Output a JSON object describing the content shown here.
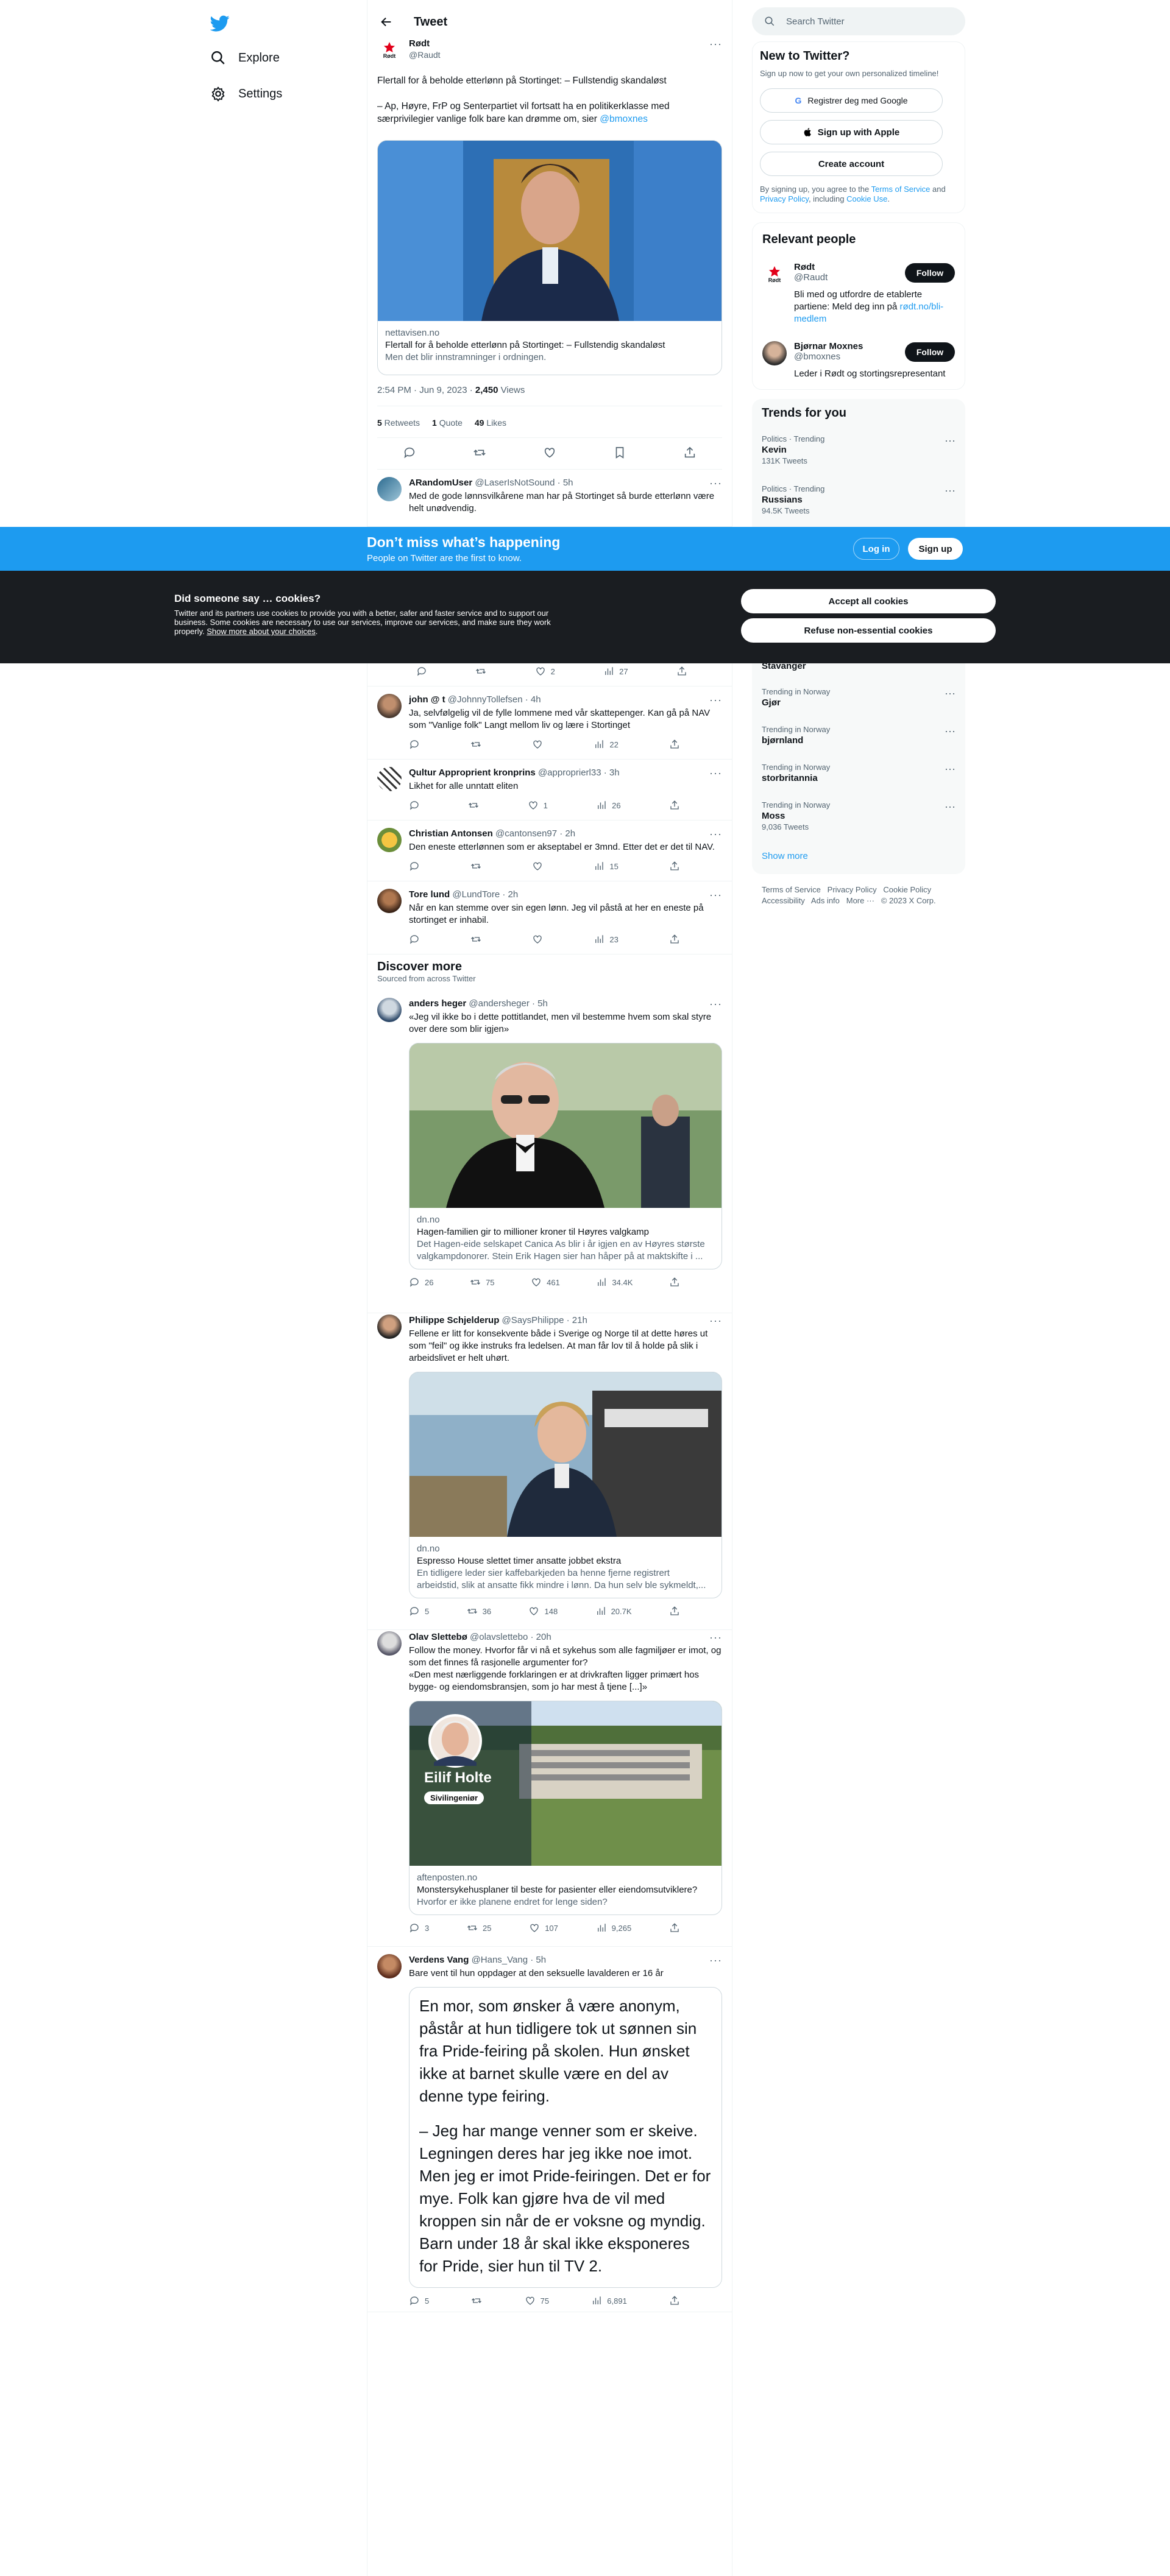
{
  "nav": {
    "explore": "Explore",
    "settings": "Settings"
  },
  "header": {
    "title": "Tweet"
  },
  "tweet": {
    "name": "Rødt",
    "handle": "@Raudt",
    "text1": "Flertall for å beholde etterlønn på Stortinget: – Fullstendig skandaløst",
    "text2": "– Ap, Høyre, FrP og Senterpartiet vil fortsatt ha en politikerklasse med særprivilegier vanlige folk bare kan drømme om, sier ",
    "mention": "@bmoxnes",
    "card": {
      "domain": "nettavisen.no",
      "title": "Flertall for å beholde etterlønn på Stortinget: – Fullstendig skandaløst",
      "desc": "Men det blir innstramninger i ordningen."
    },
    "time": "2:54 PM · Jun 9, 2023 · ",
    "views_num": "2,450",
    "views_label": " Views",
    "retweets": "5",
    "retweets_label": " Retweets",
    "quotes": "1",
    "quotes_label": " Quote",
    "likes": "49",
    "likes_label": " Likes"
  },
  "replies": [
    {
      "name": "ARandomUser",
      "handle": "@LaserIsNotSound · 5h",
      "text": "Med de gode lønnsvilkårene man har på Stortinget så burde etterlønn være helt unødvendig."
    },
    {
      "name": "",
      "handle": "",
      "text": "",
      "likes": "2",
      "views": "27"
    },
    {
      "name": "john @ t",
      "handle": "@JohnnyTollefsen · 4h",
      "text": "Ja, selvfølgelig vil de fylle lommene med vår skattepenger. Kan gå på NAV som \"Vanlige folk\" Langt mellom liv og lære i Stortinget",
      "views": "22"
    },
    {
      "name": "Qultur Approprient kronprins",
      "handle": "@approprierl33 · 3h",
      "text": "Likhet for alle unntatt eliten",
      "likes": "1",
      "views": "26"
    },
    {
      "name": "Christian Antonsen",
      "handle": "@cantonsen97 · 2h",
      "text": "Den eneste etterlønnen som er akseptabel er 3mnd. Etter det er det til NAV.",
      "views": "15"
    },
    {
      "name": "Tore lund",
      "handle": "@LundTore · 2h",
      "text": "Når en kan stemme over sin egen lønn. Jeg vil påstå at her en eneste på stortinget er inhabil.",
      "views": "23"
    }
  ],
  "discover": {
    "title": "Discover more",
    "sub": "Sourced from across Twitter"
  },
  "posts": [
    {
      "name": "anders heger",
      "handle": "@andersheger · 5h",
      "text": "«Jeg vil ikke bo i dette pottitlandet, men vil bestemme hvem som skal styre over dere som blir igjen»",
      "domain": "dn.no",
      "title": "Hagen-familien gir to millioner kroner til Høyres valgkamp",
      "desc": "Det Hagen-eide selskapet Canica As blir i år igjen en av Høyres største valgkampdonorer. Stein Erik Hagen sier han håper på at maktskifte i ...",
      "replies": "26",
      "retweets": "75",
      "likes": "461",
      "views": "34.4K"
    },
    {
      "name": "Philippe Schjelderup",
      "handle": "@SaysPhilippe · 21h",
      "text": "Fellene er litt for konsekvente både i Sverige og Norge til at dette høres ut som \"feil\" og ikke instruks fra ledelsen. At man får lov til å holde på slik i arbeidslivet er helt uhørt.",
      "domain": "dn.no",
      "title": "Espresso House slettet timer ansatte jobbet ekstra",
      "desc": "En tidligere leder sier kaffebarkjeden ba henne fjerne registrert arbeidstid, slik at ansatte fikk mindre i lønn. Da hun selv ble sykmeldt,...",
      "replies": "5",
      "retweets": "36",
      "likes": "148",
      "views": "20.7K"
    },
    {
      "name": "Olav Slettebø",
      "handle": "@olavslettebo · 20h",
      "text": "Follow the money. Hvorfor får vi nå et sykehus som alle fagmiljøer er imot, og som det finnes få rasjonelle argumenter for?\n«Den mest nærliggende forklaringen er at drivkraften ligger primært hos bygge- og eiendomsbransjen, som jo har mest å tjene [...]»",
      "domain": "aftenposten.no",
      "title": "Monstersykehusplaner til beste for pasienter eller eiendomsutviklere?",
      "desc": "Hvorfor er ikke planene endret for lenge siden?",
      "overlay_name": "Eilif Holte",
      "overlay_role": "Sivilingeniør",
      "replies": "3",
      "retweets": "25",
      "likes": "107",
      "views": "9,265"
    },
    {
      "name": "Verdens Vang",
      "handle": "@Hans_Vang · 5h",
      "text": "Bare vent til hun oppdager at den seksuelle lavalderen er 16 år",
      "quote1": "En mor, som ønsker å være anonym, påstår at hun tidligere tok ut sønnen sin fra Pride-feiring på skolen. Hun ønsket ikke at barnet skulle være en del av denne type feiring.",
      "quote2": "– Jeg har mange venner som er skeive. Legningen deres har jeg ikke noe imot. Men jeg er imot Pride-feiringen. Det er for mye. Folk kan gjøre hva de vil med kroppen sin når de er voksne og myndig. Barn under 18 år skal ikke eksponeres for Pride, sier hun til TV 2.",
      "replies": "5",
      "likes": "75",
      "views": "6,891"
    }
  ],
  "search": {
    "placeholder": "Search Twitter"
  },
  "new": {
    "title": "New to Twitter?",
    "sub": "Sign up now to get your own personalized timeline!",
    "google": "Registrer deg med Google",
    "apple": "Sign up with Apple",
    "create": "Create account",
    "terms1": "By signing up, you agree to the ",
    "terms_link": "Terms of Service",
    "terms2": " and ",
    "privacy": "Privacy Policy",
    "terms3": ", including ",
    "cookie": "Cookie Use",
    "terms4": "."
  },
  "relevant": {
    "title": "Relevant people",
    "people": [
      {
        "name": "Rødt",
        "handle": "@Raudt",
        "bio": "Bli med og utfordre de etablerte partiene: Meld deg inn på ",
        "bio_link": "rødt.no/bli-medlem",
        "follow": "Follow"
      },
      {
        "name": "Bjørnar Moxnes",
        "handle": "@bmoxnes",
        "bio": "Leder i Rødt og stortingsrepresentant",
        "follow": "Follow"
      }
    ]
  },
  "trends": {
    "title": "Trends for you",
    "items": [
      {
        "cat": "Politics · Trending",
        "name": "Kevin",
        "count": "131K Tweets"
      },
      {
        "cat": "Politics · Trending",
        "name": "Russians",
        "count": "94.5K Tweets"
      },
      {
        "cat": "",
        "name": "Stavanger",
        "count": ""
      },
      {
        "cat": "Trending in Norway",
        "name": "Gjør",
        "count": ""
      },
      {
        "cat": "Trending in Norway",
        "name": "bjørnland",
        "count": ""
      },
      {
        "cat": "Trending in Norway",
        "name": "storbritannia",
        "count": ""
      },
      {
        "cat": "Trending in Norway",
        "name": "Moss",
        "count": "9,036 Tweets"
      }
    ],
    "more": "Show more"
  },
  "footer": {
    "l1": "Terms of Service",
    "l2": "Privacy Policy",
    "l3": "Cookie Policy",
    "l4": "Accessibility",
    "l5": "Ads info",
    "l6": "More ···",
    "l7": "© 2023 X Corp."
  },
  "banner": {
    "title": "Don’t miss what’s happening",
    "sub": "People on Twitter are the first to know.",
    "login": "Log in",
    "signup": "Sign up"
  },
  "cookies": {
    "title": "Did someone say … cookies?",
    "text": "Twitter and its partners use cookies to provide you with a better, safer and faster service and to support our business. Some cookies are necessary to use our services, improve our services, and make sure they work properly. ",
    "link": "Show more about your choices",
    "accept": "Accept all cookies",
    "refuse": "Refuse non-essential cookies"
  },
  "colors": {
    "accent": "#1d9bf0",
    "text": "#0f1419",
    "muted": "#536471",
    "cookie_bg": "#1a1d21"
  }
}
